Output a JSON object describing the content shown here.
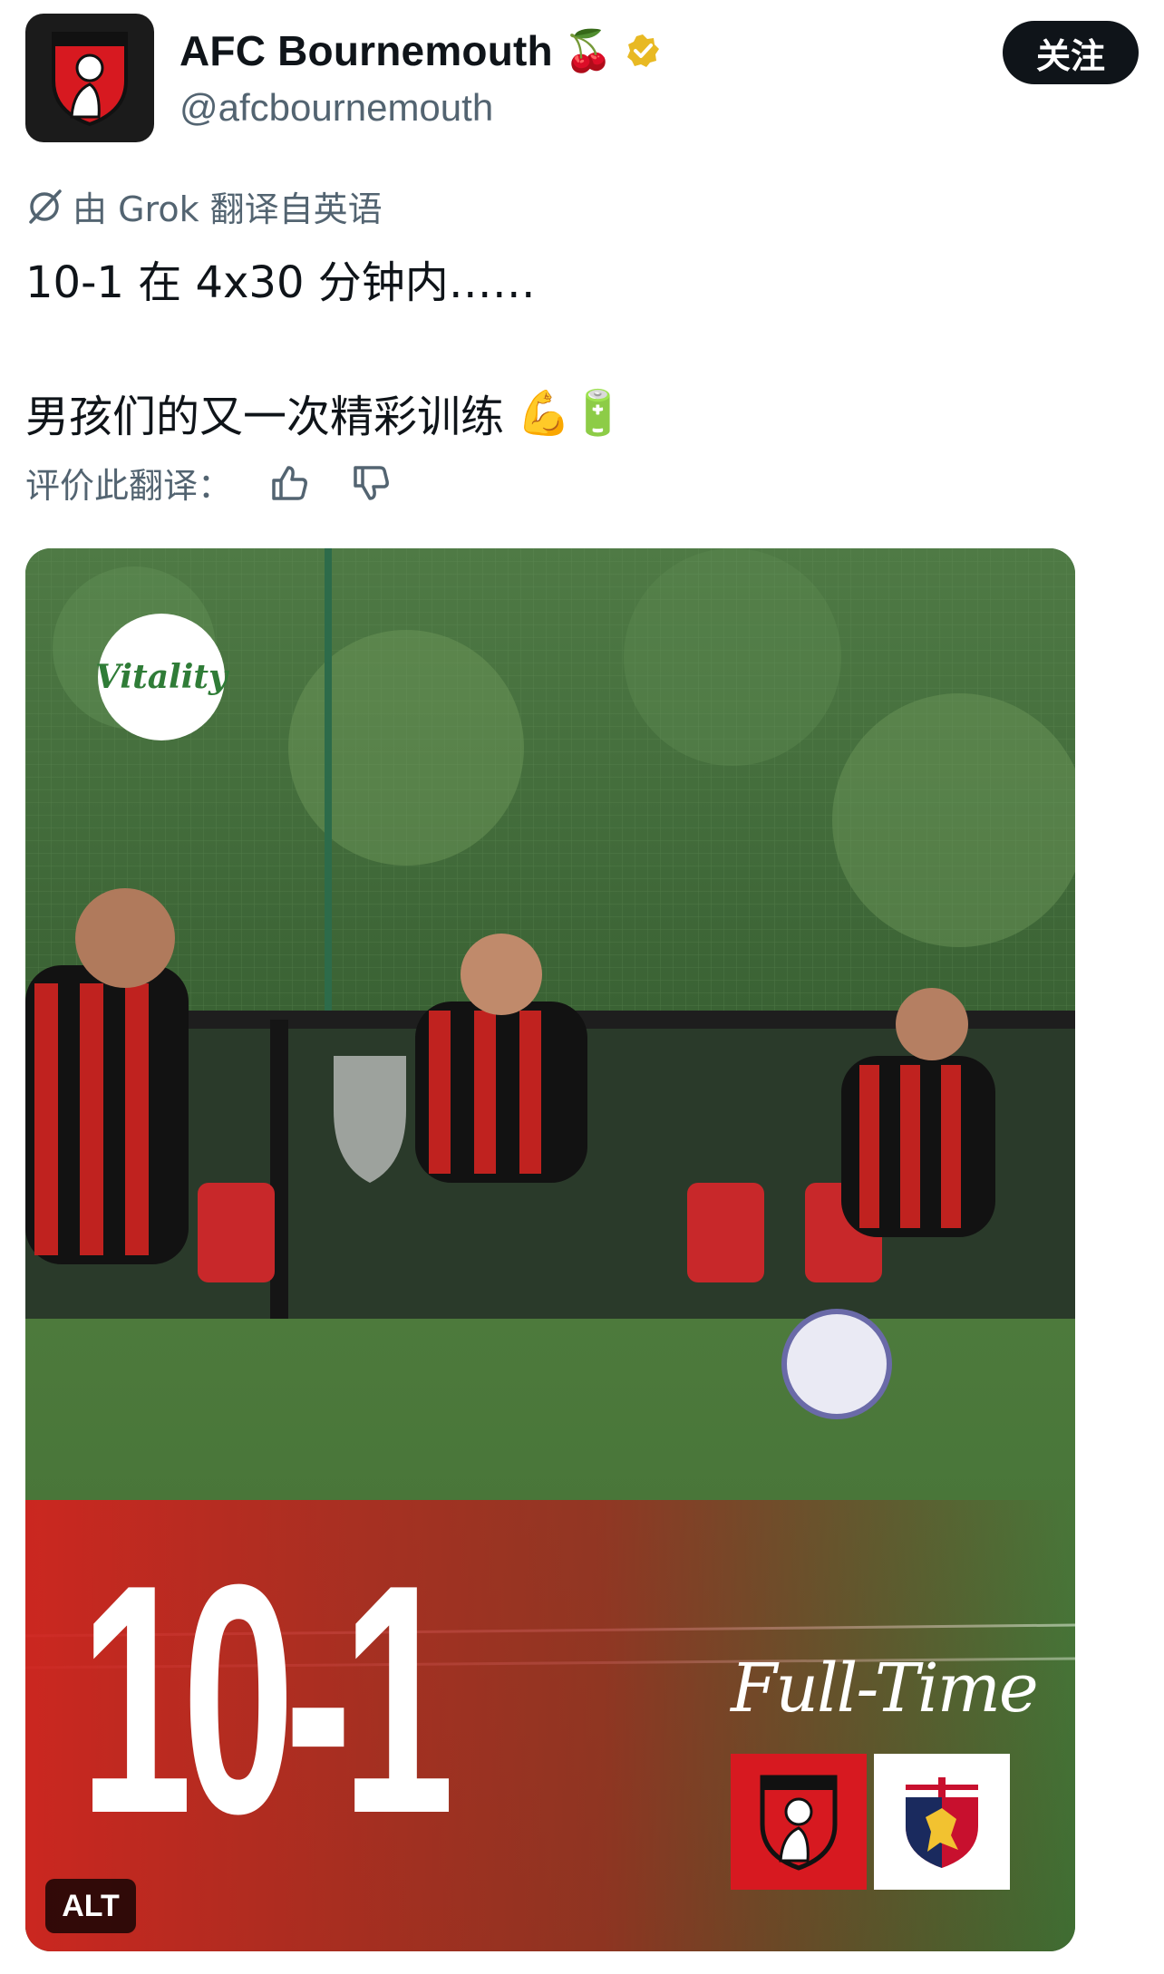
{
  "account": {
    "display_name": "AFC Bournemouth",
    "handle": "@afcbournemouth",
    "name_emoji": "🍒",
    "verified": true,
    "follow_label": "关注"
  },
  "tweet": {
    "translation_note": "由 Grok 翻译自英语",
    "line1": "10-1 在 4x30 分钟内……",
    "line2": "男孩们的又一次精彩训练",
    "line2_emoji": "💪🔋",
    "rate_label": "评价此翻译："
  },
  "media": {
    "sponsor": "Vitality",
    "score": "10-1",
    "full_time": "Full-Time",
    "alt_badge": "ALT",
    "home_crest": "afc-bournemouth-crest",
    "away_crest": "genoa-crest"
  },
  "colors": {
    "text_primary": "#0f1419",
    "text_secondary": "#536471",
    "follow_bg": "#0f1419",
    "club_red": "#d71920",
    "verified_gold": "#e8b923"
  }
}
